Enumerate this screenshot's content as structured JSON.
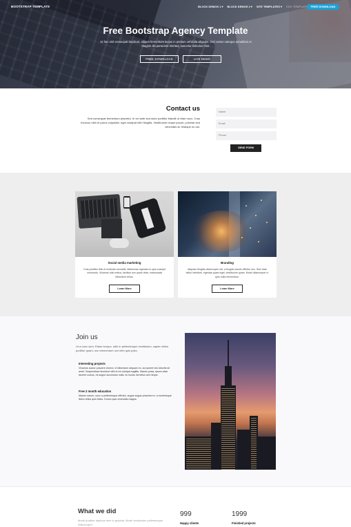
{
  "nav": {
    "brand": "BOOTSTRAP TEMPLATE",
    "items": [
      "BLOCK DEMOS 1 ▾",
      "BLOCK DEMOS 2 ▾",
      "SITE TEMPLATES ▾",
      "DOC TEMPLATES ▾"
    ],
    "cta": "FREE DOWNLOAD",
    "colors": {
      "accent": "#1aa3d9"
    }
  },
  "hero": {
    "title": "Free Bootstrap Agency Template",
    "subtitle": "Ut hac nisl consequat tincidunt, aliquet fermentum lectus in pretium vehicula aliquam. Orci varius natoque penatibus et magnis dis parturient montes, nascetur ridiculus mus.",
    "buttons": [
      "FREE DOWNLOAD",
      "LIVE DEMO"
    ]
  },
  "contact": {
    "title": "Contact us",
    "text": "Sed consequat fermentum pharetra. In vel ante sed dolor porttitor blandit ut vitae nunc. Cras rhoncus nibh et purus vulputate, eget volutpat nibh fringilla. Vestibulum neque ipsum, pulvinar sed venenatis at, tristique eu dui.",
    "fields": {
      "name": "Name",
      "email": "Email",
      "phone": "Phone"
    },
    "submit": "SEND FORM"
  },
  "cards": [
    {
      "title": "Social media marketing",
      "text": "Cras porttitor felis et molestie convallis. Maecenas egestas ex quis suscipit commodo. Vivamus odio metus, facilisis non quam vitae, malesuada bibendum tellus.",
      "button": "Learn More"
    },
    {
      "title": "Branding",
      "text": "Aliquam fringilla ullamcorper est, a feugiat mauris efficitur nec. Sed vitae tellus interdum, egestas quam eget, vestibulum quam. Morbi ullamcorper in quis nulla elementum.",
      "button": "Learn More"
    }
  ],
  "join": {
    "title": "Join us",
    "text": "Ut a nunc sem. Etiam tempor, nibh in pellentesque vestibulum, sapien tellus porttitor quam, non elementum orci nibh quis justo.",
    "features": [
      {
        "title": "Interesting projects",
        "text": "Vivamus auctor posuere viverra. In bibendum aliquam ex, ac laoreet nisl lobortis sit amet. Suspendisse tincidunt nibh in mi volutpat sagittis. Mauris porta, ipsum vitae laoreet cursus, mi augue accumsan nulla, eu luctus dui tellus sed neque."
      },
      {
        "title": "Free 2 month education",
        "text": "Mauris rutrum, nunc a pellentesque efficitur, augue augue pharetra ex, in scelerisque libero tellus quis tellus. Donec quis venenatis magna."
      }
    ]
  },
  "did": {
    "title": "What we did",
    "text": "Morbi porttitor dapibus sem in gravida. Morbi vestibulum pellentesque ullamcorper.",
    "stats": [
      {
        "number": "999",
        "label": "Happy clients"
      },
      {
        "number": "1999",
        "label": "Finished projects"
      }
    ]
  }
}
